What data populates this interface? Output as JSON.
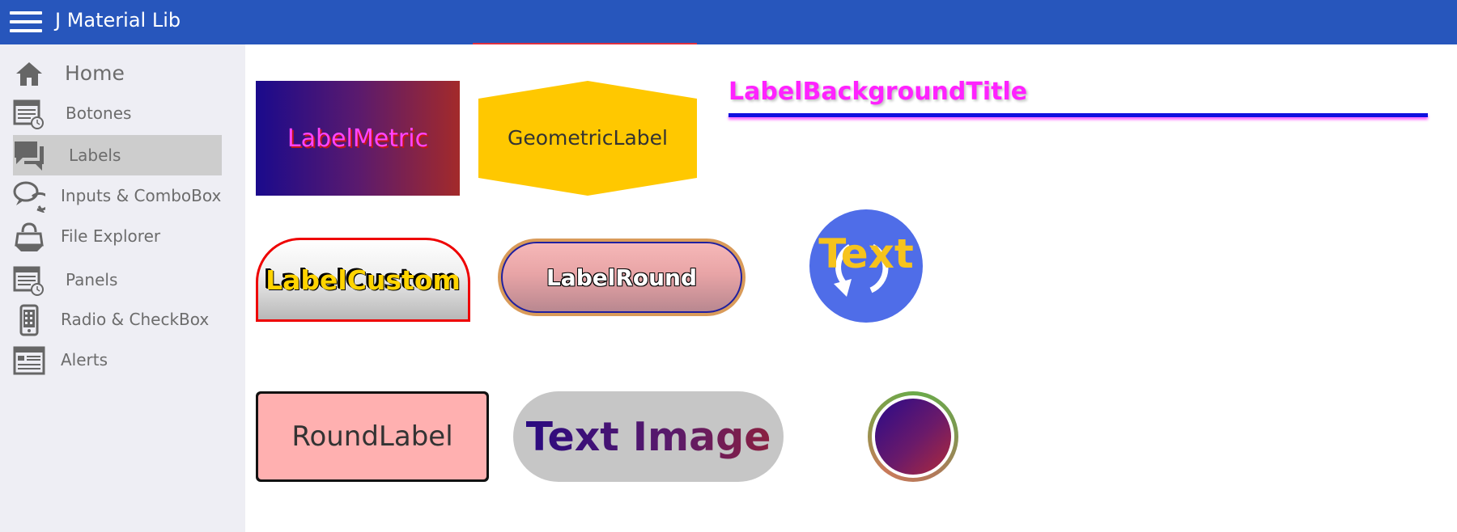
{
  "app": {
    "title": "J Material Lib"
  },
  "sidebar": {
    "items": [
      {
        "label": "Home",
        "icon": "home-icon",
        "active": false
      },
      {
        "label": "Botones",
        "icon": "calendar-clock-icon",
        "active": false
      },
      {
        "label": "Labels",
        "icon": "chat-bubble-icon",
        "active": true
      },
      {
        "label": "Inputs & ComboBox",
        "icon": "speech-bubbles-icon",
        "active": false
      },
      {
        "label": "File Explorer",
        "icon": "shopping-bag-icon",
        "active": false
      },
      {
        "label": "Panels",
        "icon": "calendar-clock-icon",
        "active": false
      },
      {
        "label": "Radio & CheckBox",
        "icon": "mobile-phone-icon",
        "active": false
      },
      {
        "label": "Alerts",
        "icon": "window-list-icon",
        "active": false
      }
    ]
  },
  "labels": {
    "metric": "LabelMetric",
    "geometric": "GeometricLabel",
    "background_title": "LabelBackgroundTitle",
    "custom": "LabelCustom",
    "round": "LabelRound",
    "text_circle": "Text",
    "round_label": "RoundLabel",
    "text_image": "Text Image"
  },
  "colors": {
    "topbar": "#2756bc",
    "sidebar_bg": "#eeeef4",
    "active_item": "#cdcdcd",
    "geometric_fill": "#ffc800",
    "magenta_text": "#ff22ff",
    "gold_text": "#ffd400"
  }
}
